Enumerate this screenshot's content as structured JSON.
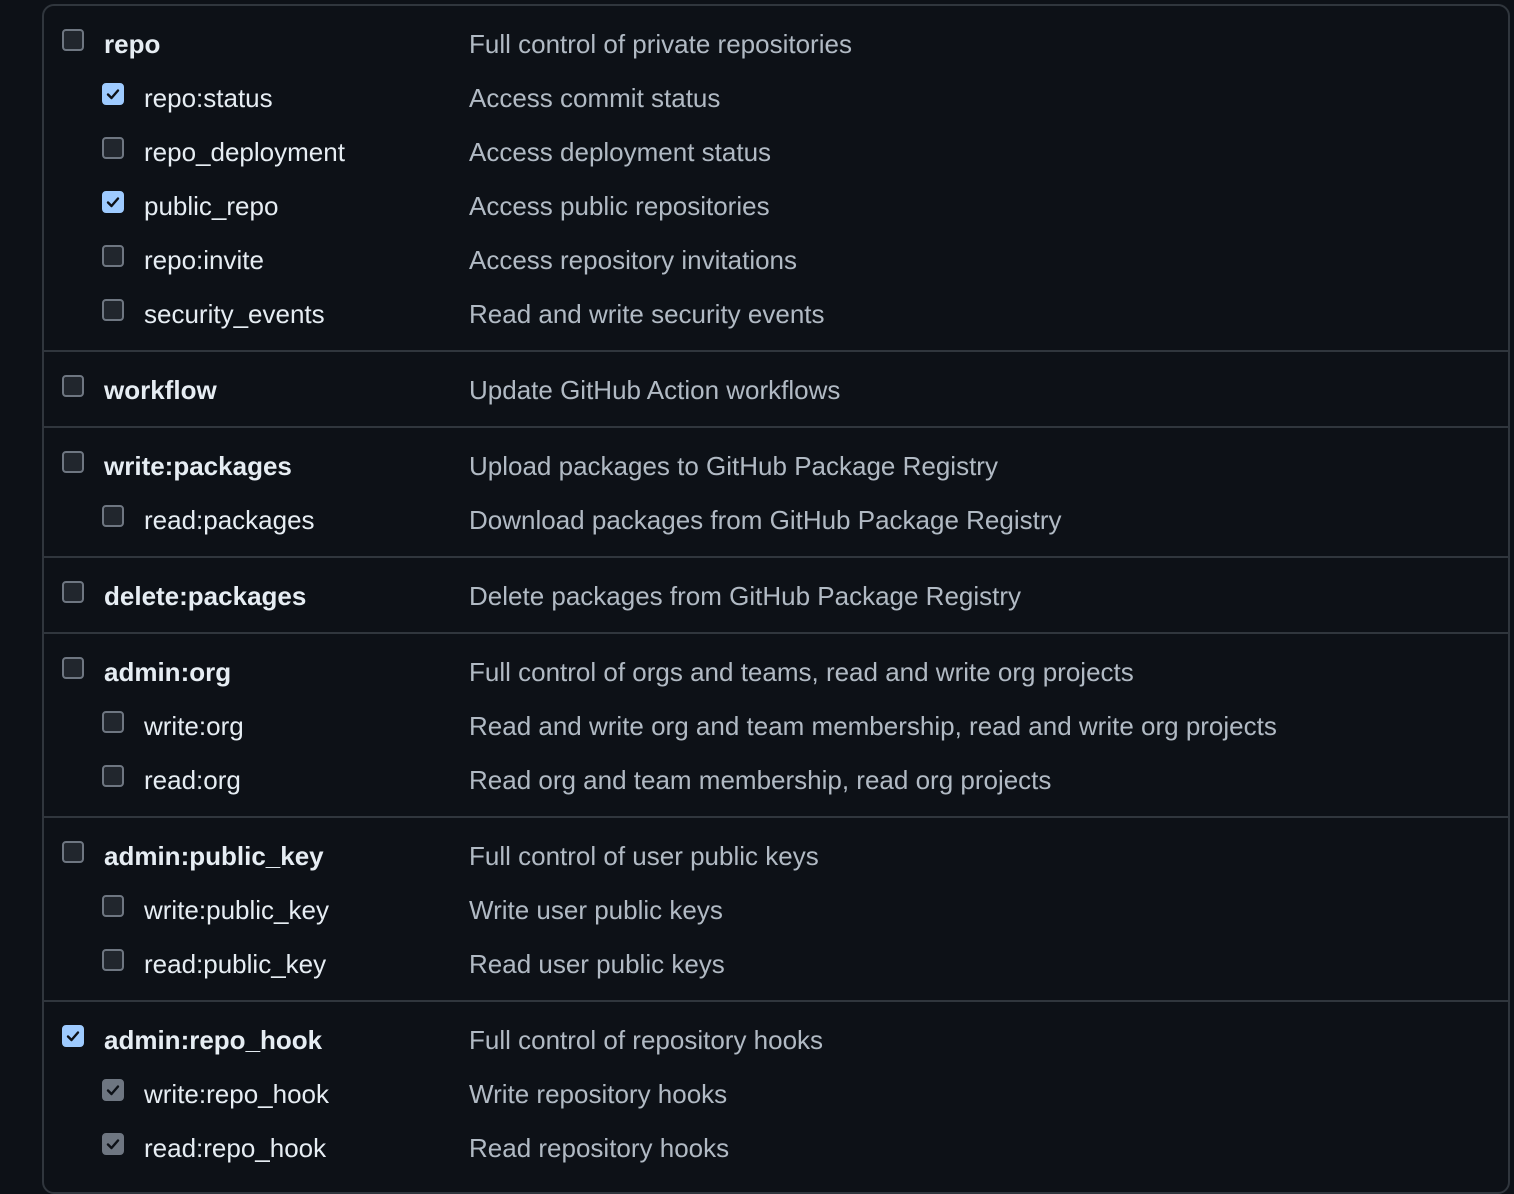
{
  "colors": {
    "background": "#0d1117",
    "border": "#30363d",
    "checked_accent": "#9ecbff",
    "checked_muted": "#6e7681",
    "description_text": "#b1bac4"
  },
  "scope_groups": [
    {
      "scopes": [
        {
          "name": "repo",
          "description": "Full control of private repositories",
          "state": "unchecked",
          "level": "parent"
        },
        {
          "name": "repo:status",
          "description": "Access commit status",
          "state": "checked",
          "level": "child"
        },
        {
          "name": "repo_deployment",
          "description": "Access deployment status",
          "state": "unchecked",
          "level": "child"
        },
        {
          "name": "public_repo",
          "description": "Access public repositories",
          "state": "checked",
          "level": "child"
        },
        {
          "name": "repo:invite",
          "description": "Access repository invitations",
          "state": "unchecked",
          "level": "child"
        },
        {
          "name": "security_events",
          "description": "Read and write security events",
          "state": "unchecked",
          "level": "child"
        }
      ]
    },
    {
      "scopes": [
        {
          "name": "workflow",
          "description": "Update GitHub Action workflows",
          "state": "unchecked",
          "level": "parent"
        }
      ]
    },
    {
      "scopes": [
        {
          "name": "write:packages",
          "description": "Upload packages to GitHub Package Registry",
          "state": "unchecked",
          "level": "parent"
        },
        {
          "name": "read:packages",
          "description": "Download packages from GitHub Package Registry",
          "state": "unchecked",
          "level": "child"
        }
      ]
    },
    {
      "scopes": [
        {
          "name": "delete:packages",
          "description": "Delete packages from GitHub Package Registry",
          "state": "unchecked",
          "level": "parent"
        }
      ]
    },
    {
      "scopes": [
        {
          "name": "admin:org",
          "description": "Full control of orgs and teams, read and write org projects",
          "state": "unchecked",
          "level": "parent"
        },
        {
          "name": "write:org",
          "description": "Read and write org and team membership, read and write org projects",
          "state": "unchecked",
          "level": "child"
        },
        {
          "name": "read:org",
          "description": "Read org and team membership, read org projects",
          "state": "unchecked",
          "level": "child"
        }
      ]
    },
    {
      "scopes": [
        {
          "name": "admin:public_key",
          "description": "Full control of user public keys",
          "state": "unchecked",
          "level": "parent"
        },
        {
          "name": "write:public_key",
          "description": "Write user public keys",
          "state": "unchecked",
          "level": "child"
        },
        {
          "name": "read:public_key",
          "description": "Read user public keys",
          "state": "unchecked",
          "level": "child"
        }
      ]
    },
    {
      "scopes": [
        {
          "name": "admin:repo_hook",
          "description": "Full control of repository hooks",
          "state": "checked",
          "level": "parent"
        },
        {
          "name": "write:repo_hook",
          "description": "Write repository hooks",
          "state": "checked-muted",
          "level": "child"
        },
        {
          "name": "read:repo_hook",
          "description": "Read repository hooks",
          "state": "checked-muted",
          "level": "child"
        }
      ]
    }
  ]
}
